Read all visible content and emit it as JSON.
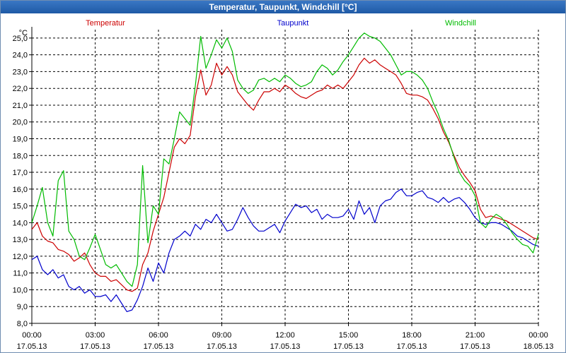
{
  "window": {
    "title": "Temperatur, Taupunkt, Windchill [°C]"
  },
  "chart_data": {
    "type": "line",
    "title": "Temperatur, Taupunkt, Windchill [°C]",
    "ylabel": "°C",
    "xlabel": "",
    "ylim": [
      8.0,
      25.5
    ],
    "xlim": [
      0,
      24
    ],
    "grid": true,
    "legend_placement": "top",
    "yticks": [
      "8,0",
      "9,0",
      "10,0",
      "11,0",
      "12,0",
      "13,0",
      "14,0",
      "15,0",
      "16,0",
      "17,0",
      "18,0",
      "19,0",
      "20,0",
      "21,0",
      "22,0",
      "23,0",
      "24,0",
      "25,0"
    ],
    "xticks": [
      {
        "x": 0,
        "time": "00:00",
        "date": "17.05.13"
      },
      {
        "x": 3,
        "time": "03:00",
        "date": "17.05.13"
      },
      {
        "x": 6,
        "time": "06:00",
        "date": "17.05.13"
      },
      {
        "x": 9,
        "time": "09:00",
        "date": "17.05.13"
      },
      {
        "x": 12,
        "time": "12:00",
        "date": "17.05.13"
      },
      {
        "x": 15,
        "time": "15:00",
        "date": "17.05.13"
      },
      {
        "x": 18,
        "time": "18:00",
        "date": "17.05.13"
      },
      {
        "x": 21,
        "time": "21:00",
        "date": "17.05.13"
      },
      {
        "x": 24,
        "time": "00:00",
        "date": "18.05.13"
      }
    ],
    "series": [
      {
        "name": "Temperatur",
        "color": "#cc0000",
        "points": [
          [
            0,
            13.6
          ],
          [
            0.25,
            14.0
          ],
          [
            0.5,
            13.2
          ],
          [
            0.75,
            12.9
          ],
          [
            1.0,
            12.8
          ],
          [
            1.25,
            12.4
          ],
          [
            1.5,
            12.3
          ],
          [
            1.75,
            12.1
          ],
          [
            2.0,
            11.7
          ],
          [
            2.25,
            11.9
          ],
          [
            2.5,
            12.2
          ],
          [
            2.75,
            11.5
          ],
          [
            3.0,
            11.0
          ],
          [
            3.25,
            10.8
          ],
          [
            3.5,
            10.8
          ],
          [
            3.75,
            10.5
          ],
          [
            4.0,
            10.6
          ],
          [
            4.25,
            10.3
          ],
          [
            4.5,
            10.0
          ],
          [
            4.75,
            9.9
          ],
          [
            5.0,
            10.1
          ],
          [
            5.25,
            11.5
          ],
          [
            5.5,
            12.2
          ],
          [
            5.75,
            13.5
          ],
          [
            6.0,
            14.5
          ],
          [
            6.25,
            15.5
          ],
          [
            6.5,
            17.0
          ],
          [
            6.75,
            18.5
          ],
          [
            7.0,
            19.0
          ],
          [
            7.25,
            18.7
          ],
          [
            7.5,
            19.2
          ],
          [
            7.75,
            21.5
          ],
          [
            8.0,
            23.1
          ],
          [
            8.25,
            21.6
          ],
          [
            8.5,
            22.2
          ],
          [
            8.75,
            23.5
          ],
          [
            9.0,
            22.8
          ],
          [
            9.25,
            23.3
          ],
          [
            9.5,
            22.8
          ],
          [
            9.75,
            21.8
          ],
          [
            10.0,
            21.4
          ],
          [
            10.25,
            21.0
          ],
          [
            10.5,
            20.7
          ],
          [
            10.75,
            21.3
          ],
          [
            11.0,
            21.8
          ],
          [
            11.25,
            21.8
          ],
          [
            11.5,
            22.0
          ],
          [
            11.75,
            21.8
          ],
          [
            12.0,
            22.2
          ],
          [
            12.25,
            22.0
          ],
          [
            12.5,
            21.7
          ],
          [
            12.75,
            21.5
          ],
          [
            13.0,
            21.4
          ],
          [
            13.25,
            21.6
          ],
          [
            13.5,
            21.8
          ],
          [
            13.75,
            21.9
          ],
          [
            14.0,
            22.2
          ],
          [
            14.25,
            22.0
          ],
          [
            14.5,
            22.2
          ],
          [
            14.75,
            22.0
          ],
          [
            15.0,
            22.4
          ],
          [
            15.25,
            22.8
          ],
          [
            15.5,
            23.4
          ],
          [
            15.75,
            23.8
          ],
          [
            16.0,
            23.5
          ],
          [
            16.25,
            23.7
          ],
          [
            16.5,
            23.4
          ],
          [
            16.75,
            23.2
          ],
          [
            17.0,
            23.0
          ],
          [
            17.25,
            22.8
          ],
          [
            17.5,
            22.3
          ],
          [
            17.75,
            21.7
          ],
          [
            18.0,
            21.6
          ],
          [
            18.25,
            21.6
          ],
          [
            18.5,
            21.5
          ],
          [
            18.75,
            21.3
          ],
          [
            19.0,
            20.8
          ],
          [
            19.25,
            20.2
          ],
          [
            19.5,
            19.4
          ],
          [
            19.75,
            18.8
          ],
          [
            20.0,
            18.0
          ],
          [
            20.25,
            17.3
          ],
          [
            20.5,
            16.8
          ],
          [
            20.75,
            16.4
          ],
          [
            21.0,
            15.9
          ],
          [
            21.25,
            14.8
          ],
          [
            21.5,
            14.3
          ],
          [
            21.75,
            14.4
          ],
          [
            22.0,
            14.3
          ],
          [
            22.25,
            14.2
          ],
          [
            22.5,
            14.1
          ],
          [
            22.75,
            13.9
          ],
          [
            23.0,
            13.7
          ],
          [
            23.25,
            13.5
          ],
          [
            23.5,
            13.3
          ],
          [
            23.75,
            13.1
          ],
          [
            24.0,
            13.0
          ]
        ]
      },
      {
        "name": "Taupunkt",
        "color": "#0000cc",
        "points": [
          [
            0,
            11.8
          ],
          [
            0.25,
            12.0
          ],
          [
            0.5,
            11.2
          ],
          [
            0.75,
            10.9
          ],
          [
            1.0,
            11.2
          ],
          [
            1.25,
            10.7
          ],
          [
            1.5,
            10.9
          ],
          [
            1.75,
            10.2
          ],
          [
            2.0,
            10.0
          ],
          [
            2.25,
            10.2
          ],
          [
            2.5,
            9.8
          ],
          [
            2.75,
            10.0
          ],
          [
            3.0,
            9.6
          ],
          [
            3.25,
            9.6
          ],
          [
            3.5,
            9.7
          ],
          [
            3.75,
            9.3
          ],
          [
            4.0,
            9.7
          ],
          [
            4.25,
            9.2
          ],
          [
            4.5,
            8.7
          ],
          [
            4.75,
            8.8
          ],
          [
            5.0,
            9.4
          ],
          [
            5.25,
            10.2
          ],
          [
            5.5,
            11.3
          ],
          [
            5.75,
            10.5
          ],
          [
            6.0,
            11.6
          ],
          [
            6.25,
            11.0
          ],
          [
            6.5,
            12.2
          ],
          [
            6.75,
            13.0
          ],
          [
            7.0,
            13.2
          ],
          [
            7.25,
            13.5
          ],
          [
            7.5,
            13.2
          ],
          [
            7.75,
            13.9
          ],
          [
            8.0,
            13.6
          ],
          [
            8.25,
            14.2
          ],
          [
            8.5,
            14.0
          ],
          [
            8.75,
            14.5
          ],
          [
            9.0,
            14.0
          ],
          [
            9.25,
            13.5
          ],
          [
            9.5,
            13.6
          ],
          [
            9.75,
            14.2
          ],
          [
            10.0,
            14.9
          ],
          [
            10.25,
            14.3
          ],
          [
            10.5,
            13.8
          ],
          [
            10.75,
            13.5
          ],
          [
            11.0,
            13.5
          ],
          [
            11.25,
            13.7
          ],
          [
            11.5,
            13.9
          ],
          [
            11.75,
            13.4
          ],
          [
            12.0,
            14.1
          ],
          [
            12.25,
            14.6
          ],
          [
            12.5,
            15.1
          ],
          [
            12.75,
            14.9
          ],
          [
            13.0,
            15.0
          ],
          [
            13.25,
            14.6
          ],
          [
            13.5,
            14.8
          ],
          [
            13.75,
            14.2
          ],
          [
            14.0,
            14.5
          ],
          [
            14.25,
            14.3
          ],
          [
            14.5,
            14.3
          ],
          [
            14.75,
            14.4
          ],
          [
            15.0,
            14.8
          ],
          [
            15.25,
            14.2
          ],
          [
            15.5,
            15.3
          ],
          [
            15.75,
            14.5
          ],
          [
            16.0,
            14.9
          ],
          [
            16.25,
            14.0
          ],
          [
            16.5,
            15.0
          ],
          [
            16.75,
            15.3
          ],
          [
            17.0,
            15.4
          ],
          [
            17.25,
            15.8
          ],
          [
            17.5,
            16.0
          ],
          [
            17.75,
            15.6
          ],
          [
            18.0,
            15.6
          ],
          [
            18.25,
            15.8
          ],
          [
            18.5,
            15.9
          ],
          [
            18.75,
            15.5
          ],
          [
            19.0,
            15.4
          ],
          [
            19.25,
            15.2
          ],
          [
            19.5,
            15.5
          ],
          [
            19.75,
            15.2
          ],
          [
            20.0,
            15.4
          ],
          [
            20.25,
            15.5
          ],
          [
            20.5,
            15.2
          ],
          [
            20.75,
            14.8
          ],
          [
            21.0,
            14.3
          ],
          [
            21.25,
            14.0
          ],
          [
            21.5,
            13.9
          ],
          [
            21.75,
            14.0
          ],
          [
            22.0,
            14.0
          ],
          [
            22.25,
            13.9
          ],
          [
            22.5,
            13.7
          ],
          [
            22.75,
            13.5
          ],
          [
            23.0,
            13.2
          ],
          [
            23.25,
            13.1
          ],
          [
            23.5,
            12.9
          ],
          [
            23.75,
            12.7
          ],
          [
            24.0,
            12.6
          ]
        ]
      },
      {
        "name": "Windchill",
        "color": "#00bb00",
        "points": [
          [
            0,
            14.0
          ],
          [
            0.25,
            15.0
          ],
          [
            0.5,
            16.1
          ],
          [
            0.75,
            14.0
          ],
          [
            1.0,
            13.2
          ],
          [
            1.25,
            16.5
          ],
          [
            1.5,
            17.1
          ],
          [
            1.75,
            13.5
          ],
          [
            2.0,
            13.0
          ],
          [
            2.25,
            12.0
          ],
          [
            2.5,
            11.8
          ],
          [
            2.75,
            12.5
          ],
          [
            3.0,
            13.3
          ],
          [
            3.25,
            12.4
          ],
          [
            3.5,
            11.5
          ],
          [
            3.75,
            11.3
          ],
          [
            4.0,
            11.5
          ],
          [
            4.25,
            11.0
          ],
          [
            4.5,
            10.5
          ],
          [
            4.75,
            10.2
          ],
          [
            5.0,
            11.5
          ],
          [
            5.25,
            17.4
          ],
          [
            5.5,
            12.8
          ],
          [
            5.75,
            15.0
          ],
          [
            6.0,
            14.5
          ],
          [
            6.25,
            17.8
          ],
          [
            6.5,
            17.5
          ],
          [
            6.75,
            19.0
          ],
          [
            7.0,
            20.6
          ],
          [
            7.25,
            20.2
          ],
          [
            7.5,
            19.8
          ],
          [
            7.75,
            22.2
          ],
          [
            8.0,
            25.1
          ],
          [
            8.25,
            23.2
          ],
          [
            8.5,
            24.0
          ],
          [
            8.75,
            24.9
          ],
          [
            9.0,
            24.4
          ],
          [
            9.25,
            25.0
          ],
          [
            9.5,
            24.2
          ],
          [
            9.75,
            22.5
          ],
          [
            10.0,
            22.0
          ],
          [
            10.25,
            21.7
          ],
          [
            10.5,
            21.9
          ],
          [
            10.75,
            22.5
          ],
          [
            11.0,
            22.6
          ],
          [
            11.25,
            22.4
          ],
          [
            11.5,
            22.6
          ],
          [
            11.75,
            22.4
          ],
          [
            12.0,
            22.8
          ],
          [
            12.25,
            22.6
          ],
          [
            12.5,
            22.3
          ],
          [
            12.75,
            22.1
          ],
          [
            13.0,
            22.2
          ],
          [
            13.25,
            22.4
          ],
          [
            13.5,
            23.0
          ],
          [
            13.75,
            23.4
          ],
          [
            14.0,
            23.2
          ],
          [
            14.25,
            22.8
          ],
          [
            14.5,
            23.1
          ],
          [
            14.75,
            23.6
          ],
          [
            15.0,
            24.0
          ],
          [
            15.25,
            24.5
          ],
          [
            15.5,
            25.0
          ],
          [
            15.75,
            25.3
          ],
          [
            16.0,
            25.1
          ],
          [
            16.25,
            25.0
          ],
          [
            16.5,
            24.8
          ],
          [
            16.75,
            24.4
          ],
          [
            17.0,
            24.0
          ],
          [
            17.25,
            23.4
          ],
          [
            17.5,
            22.8
          ],
          [
            17.75,
            23.0
          ],
          [
            18.0,
            23.0
          ],
          [
            18.25,
            22.8
          ],
          [
            18.5,
            22.5
          ],
          [
            18.75,
            22.0
          ],
          [
            19.0,
            21.2
          ],
          [
            19.25,
            20.5
          ],
          [
            19.5,
            19.6
          ],
          [
            19.75,
            18.9
          ],
          [
            20.0,
            17.9
          ],
          [
            20.25,
            17.0
          ],
          [
            20.5,
            16.5
          ],
          [
            20.75,
            16.2
          ],
          [
            21.0,
            15.6
          ],
          [
            21.25,
            14.0
          ],
          [
            21.5,
            13.7
          ],
          [
            21.75,
            14.2
          ],
          [
            22.0,
            14.5
          ],
          [
            22.25,
            14.3
          ],
          [
            22.5,
            13.9
          ],
          [
            22.75,
            13.4
          ],
          [
            23.0,
            13.0
          ],
          [
            23.25,
            12.7
          ],
          [
            23.5,
            12.6
          ],
          [
            23.75,
            12.2
          ],
          [
            24.0,
            13.3
          ]
        ]
      }
    ]
  }
}
